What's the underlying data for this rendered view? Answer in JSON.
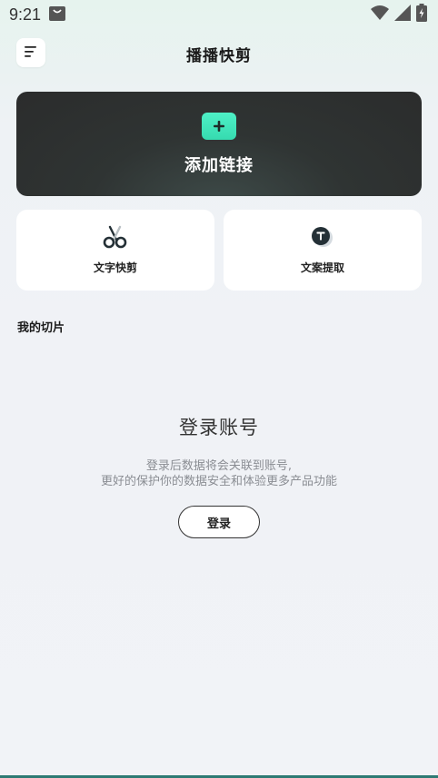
{
  "status_bar": {
    "time": "9:21"
  },
  "header": {
    "title": "播播快剪"
  },
  "add_link": {
    "label": "添加链接",
    "accent_color": "#3ee6bb"
  },
  "tools": [
    {
      "label": "文字快剪",
      "icon": "scissors-icon"
    },
    {
      "label": "文案提取",
      "icon": "text-extract-icon"
    }
  ],
  "section": {
    "title": "我的切片"
  },
  "empty_state": {
    "title": "登录账号",
    "desc_line1": "登录后数据将会关联到账号,",
    "desc_line2": "更好的保护你的数据安全和体验更多产品功能",
    "login_label": "登录"
  }
}
